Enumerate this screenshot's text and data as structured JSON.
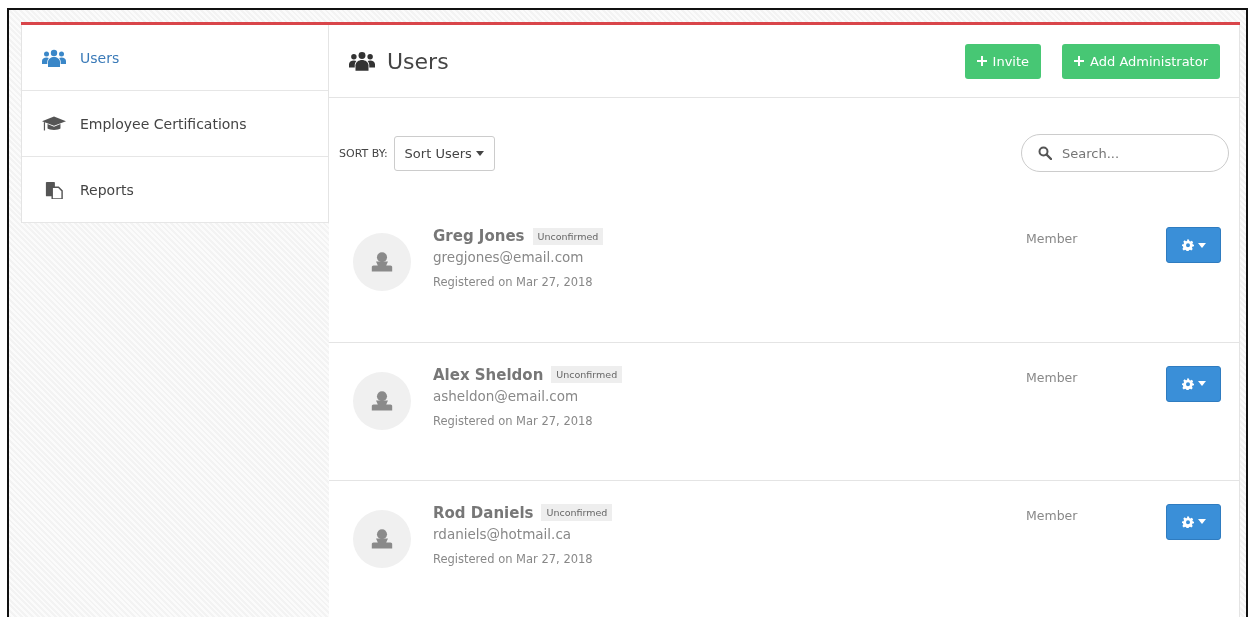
{
  "sidebar": {
    "items": [
      {
        "label": "Users",
        "selected": true
      },
      {
        "label": "Employee Certifications",
        "selected": false
      },
      {
        "label": "Reports",
        "selected": false
      }
    ]
  },
  "header": {
    "title": "Users",
    "buttons": [
      {
        "label": "Invite"
      },
      {
        "label": "Add Administrator"
      }
    ]
  },
  "toolbar": {
    "sort_label": "SORT BY:",
    "sort_button": "Sort Users",
    "search": {
      "placeholder": "Search..."
    }
  },
  "users": [
    {
      "name": "Greg Jones",
      "badge": "Unconfirmed",
      "email": "gregjones@email.com",
      "registered": "Registered on Mar 27, 2018",
      "role": "Member"
    },
    {
      "name": "Alex Sheldon",
      "badge": "Unconfirmed",
      "email": "asheldon@email.com",
      "registered": "Registered on Mar 27, 2018",
      "role": "Member"
    },
    {
      "name": "Rod Daniels",
      "badge": "Unconfirmed",
      "email": "rdaniels@hotmail.ca",
      "registered": "Registered on Mar 27, 2018",
      "role": "Member"
    }
  ]
}
